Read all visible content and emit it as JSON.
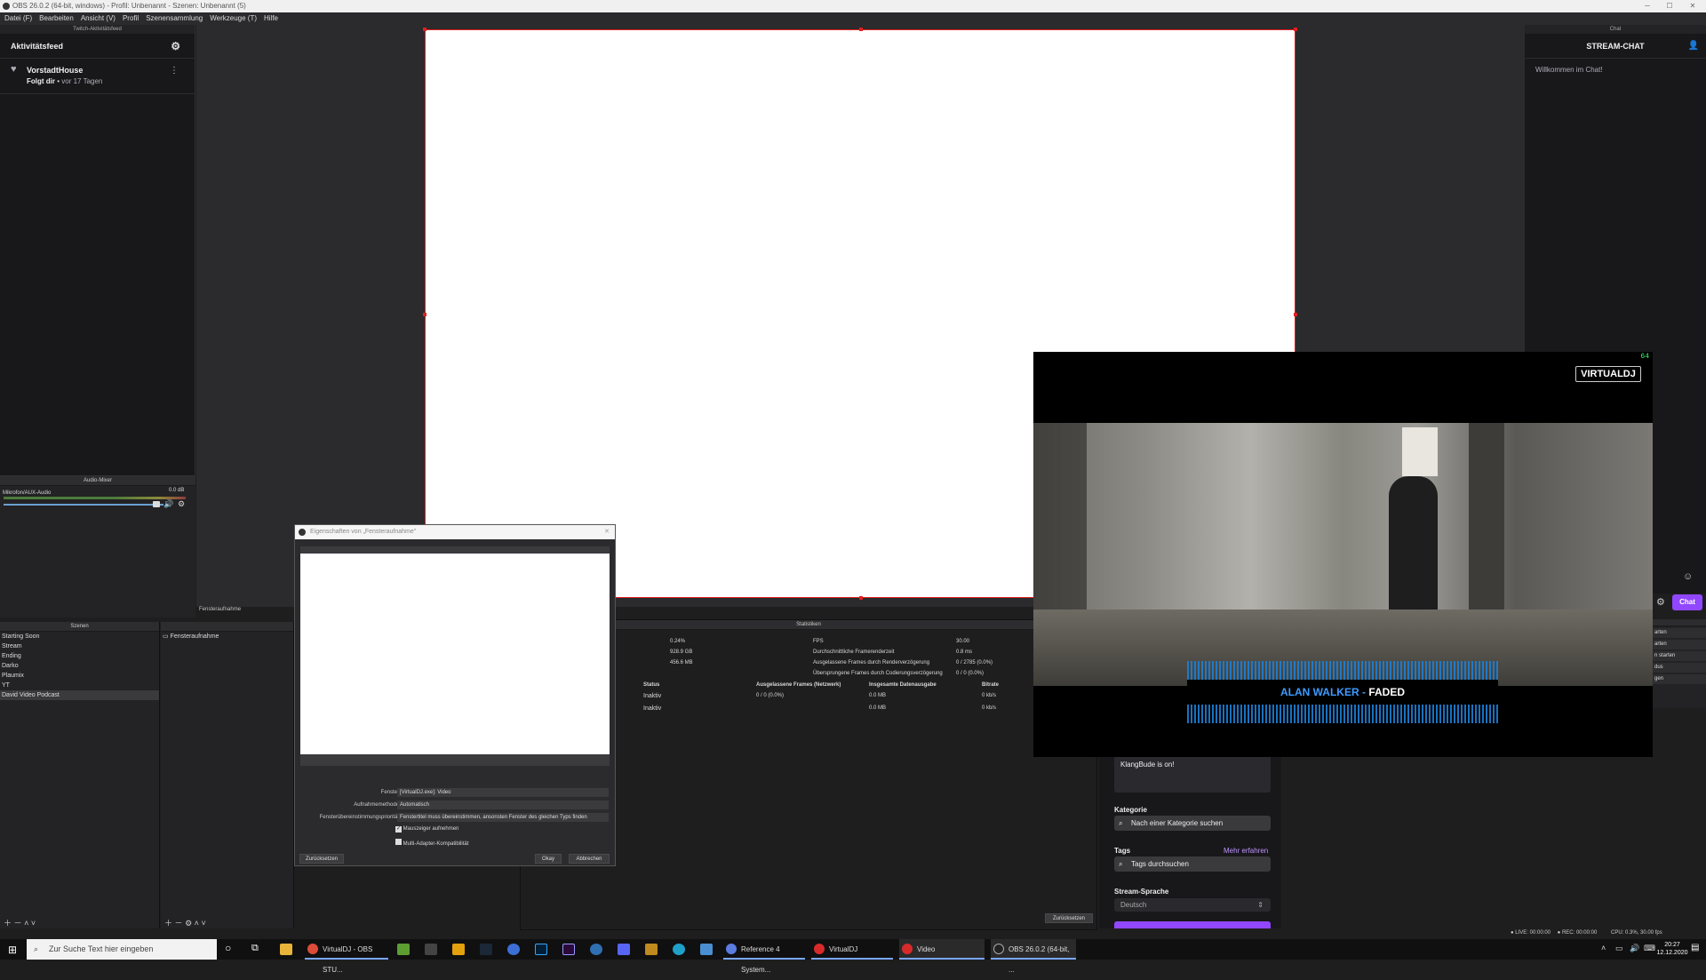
{
  "window": {
    "title": "OBS 26.0.2 (64-bit, windows) - Profil: Unbenannt - Szenen: Unbenannt (5)"
  },
  "menu": [
    "Datei (F)",
    "Bearbeiten",
    "Ansicht (V)",
    "Profil",
    "Szenensammlung",
    "Werkzeuge (T)",
    "Hilfe"
  ],
  "activity": {
    "dock_title": "Twitch-Aktivitätsfeed",
    "title": "Aktivitätsfeed",
    "item": {
      "user": "VorstadtHouse",
      "action": "Folgt dir",
      "time": "vor 17 Tagen"
    }
  },
  "chat": {
    "dock_title": "Chat",
    "title": "STREAM-CHAT",
    "welcome": "Willkommen im Chat!",
    "chat_button": "Chat"
  },
  "mixer": {
    "title": "Audio-Mixer",
    "channel": "Mikrofon/AUX-Audio",
    "level": "0.0 dB"
  },
  "scenes": {
    "title": "Szenen",
    "items": [
      "Starting Soon",
      "Stream",
      "Ending",
      "Darko",
      "Plaumix",
      "YT",
      "David Video Podcast"
    ],
    "selected": 6
  },
  "sources": {
    "title": "Fensteraufnahme",
    "items": [
      "Fensteraufnahme"
    ]
  },
  "stats": {
    "title": "Statistiken",
    "left_values": [
      "0.24%",
      "928.9 GB",
      "456.6 MB"
    ],
    "fps_label": "FPS",
    "fps_value": "30.00",
    "rows": [
      {
        "label": "Durchschnittliche Framerenderzeit",
        "value": "0.8 ms"
      },
      {
        "label": "Ausgelassene Frames durch Renderverzögerung",
        "value": "0 / 2785 (0.0%)"
      },
      {
        "label": "Übersprungene Frames durch Codierungsverzögerung",
        "value": "0 / 0 (0.0%)"
      }
    ],
    "headers": [
      "Status",
      "Ausgelassene Frames (Netzwerk)",
      "Insgesamte Datenausgabe",
      "Bitrate"
    ],
    "outputs": [
      {
        "status": "Inaktiv",
        "dropped": "0 / 0 (0.0%)",
        "total": "0.0 MB",
        "bitrate": "0 kb/s"
      },
      {
        "status": "Inaktiv",
        "dropped": "",
        "total": "0.0 MB",
        "bitrate": "0 kb/s"
      }
    ],
    "reset": "Zurücksetzen"
  },
  "dialog": {
    "title": "Eigenschaften von „Fensteraufnahme\"",
    "fields": [
      {
        "label": "Fenster",
        "value": "[VirtualDJ.exe]: Video"
      },
      {
        "label": "Aufnahmemethode",
        "value": "Automatisch"
      },
      {
        "label": "Fensterübereinstimmungspriorität",
        "value": "Fenstertitel muss übereinstimmen, ansonsten Fenster des gleichen Typs finden"
      }
    ],
    "checks": [
      "Mauszeiger aufnehmen",
      "Multi-Adapter-Kompatibilität"
    ],
    "reset": "Zurücksetzen",
    "ok": "Okay",
    "cancel": "Abbrechen"
  },
  "source_label": "Fensteraufnahme",
  "vdj": {
    "logo": "VIRTUALDJ",
    "fps": "64",
    "artist": "ALAN WALKER",
    "separator": " - ",
    "song": "FADED"
  },
  "twitch": {
    "notify": "KlangBude is on!",
    "category_label": "Kategorie",
    "category_placeholder": "Nach einer Kategorie suchen",
    "tags_label": "Tags",
    "tags_more": "Mehr erfahren",
    "tags_placeholder": "Tags durchsuchen",
    "lang_label": "Stream-Sprache",
    "lang_value": "Deutsch"
  },
  "side_labels": [
    "arten",
    "arten",
    "n starten",
    "dus",
    "gen"
  ],
  "statusbar": {
    "live": "LIVE: 00:00:00",
    "rec": "REC: 00:00:00",
    "cpu": "CPU: 0.3%, 30.00 fps"
  },
  "taskbar": {
    "search": "Zur Suche Text hier eingeben",
    "apps": [
      "VirtualDJ - OBS STU...",
      "Reference 4 System...",
      "VirtualDJ",
      "Video",
      "OBS 26.0.2 (64-bit, ..."
    ],
    "time": "20:27",
    "date": "12.12.2020"
  }
}
